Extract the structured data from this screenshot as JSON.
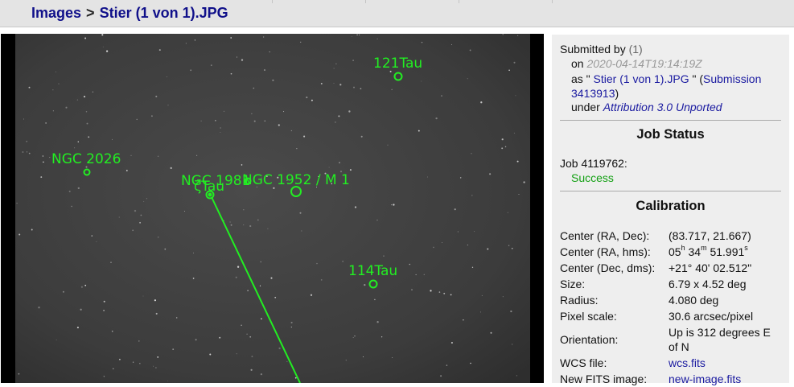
{
  "breadcrumb": {
    "images": "Images",
    "sep": ">",
    "current": "Stier (1 von 1).JPG"
  },
  "sky": {
    "labels": {
      "l121": "121Tau",
      "ngc2026": "NGC 2026",
      "ngc1981": "NGC 1981",
      "zeta": "ζTau",
      "m1": "NGC 1952 / M 1",
      "l114": "114Tau"
    },
    "overlay_color": "#22ee22"
  },
  "submitted": {
    "by_label": "Submitted by",
    "by_value": "(1)",
    "on_label": "on",
    "date": "2020-04-14T19:14:19Z",
    "as_label": "as \"",
    "file": "Stier (1 von 1).JPG",
    "as_close": "\" (",
    "submission_link": "Submission 3413913",
    "paren_close": ")",
    "under_label": "under",
    "license": "Attribution 3.0 Unported"
  },
  "job_status": {
    "header": "Job Status",
    "job": "Job 4119762:",
    "status": "Success"
  },
  "calibration": {
    "header": "Calibration",
    "center_radec_label": "Center (RA, Dec):",
    "center_radec_value": "(83.717, 21.667)",
    "center_hms_label": "Center (RA, hms):",
    "hms": {
      "h": "05",
      "h_unit": "h",
      "m": "34",
      "m_unit": "m",
      "s": "51.991",
      "s_unit": "s"
    },
    "center_dms_label": "Center (Dec, dms):",
    "center_dms_value": "+21° 40' 02.512\"",
    "size_label": "Size:",
    "size_value": "6.79 x 4.52 deg",
    "radius_label": "Radius:",
    "radius_value": "4.080 deg",
    "pixel_scale_label": "Pixel scale:",
    "pixel_scale_value": "30.6 arcsec/pixel",
    "orientation_label": "Orientation:",
    "orientation_value": "Up is 312 degrees E of N",
    "wcs_label": "WCS file:",
    "wcs_value": "wcs.fits",
    "newfits_label": "New FITS image:",
    "newfits_value": "new-image.fits"
  }
}
